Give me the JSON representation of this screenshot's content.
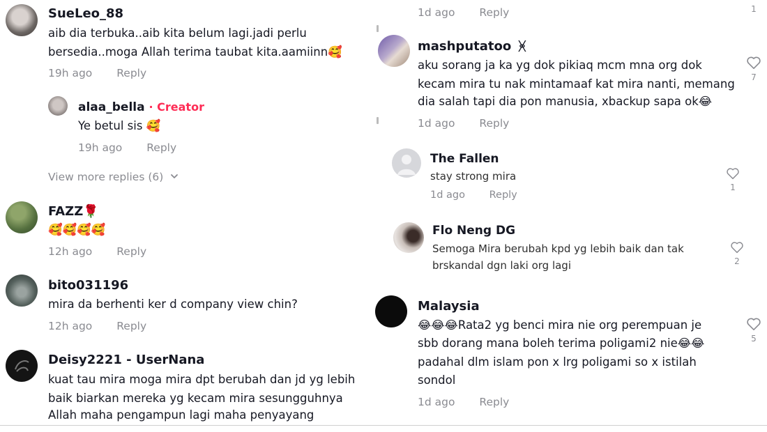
{
  "left": {
    "comments": [
      {
        "username": "SueLeo_88",
        "lines": [
          "aib dia terbuka..aib kita belum lagi.jadi perlu",
          "bersedia..moga Allah terima taubat kita.aamiinn🥰"
        ],
        "time": "19h ago",
        "reply": "Reply"
      },
      {
        "username": "alaa_bella",
        "creator_badge": "· Creator",
        "lines": [
          "Ye betul sis 🥰"
        ],
        "time": "19h ago",
        "reply": "Reply"
      },
      {
        "username": "FAZZ🌹",
        "lines": [
          "🥰🥰🥰🥰"
        ],
        "time": "12h ago",
        "reply": "Reply"
      },
      {
        "username": "bito031196",
        "lines": [
          "mira da berhenti ker d company view chin?"
        ],
        "time": "12h ago",
        "reply": "Reply"
      },
      {
        "username": "Deisy2221 - UserNana",
        "lines": [
          "kuat tau mira moga mira dpt berubah dan jd yg lebih",
          "baik biarkan mereka yg kecam mira sesungguhnya",
          "Allah maha pengampun lagi maha penyayang"
        ]
      }
    ],
    "view_more": "View more replies (6)"
  },
  "right": {
    "top_meta": {
      "time": "1d ago",
      "reply": "Reply",
      "count": "1"
    },
    "comments": [
      {
        "username": "mashputatoo",
        "user_suffix": "ᚸ",
        "lines": [
          "aku sorang ja ka yg dok pikiaq mcm mna org dok",
          "kecam mira tu nak mintamaaf kat mira nanti, memang",
          "dia salah tapi dia pon manusia, xbackup sapa ok😂"
        ],
        "time": "1d ago",
        "reply": "Reply",
        "likes": "7"
      },
      {
        "username": "The Fallen",
        "lines": [
          "stay strong mira"
        ],
        "time": "1d ago",
        "reply": "Reply",
        "likes": "1"
      },
      {
        "username": "Flo Neng DG",
        "lines": [
          "Semoga Mira berubah kpd yg lebih baik dan tak",
          "brskandal dgn laki org lagi"
        ],
        "likes": "2"
      },
      {
        "username": "Malaysia",
        "lines": [
          "😂😂😂Rata2 yg benci mira nie org perempuan je",
          "sbb dorang mana boleh terima poligami2 nie😂😂",
          "padahal dlm islam pon x lrg poligami so x istilah",
          "sondol"
        ],
        "time": "1d ago",
        "reply": "Reply",
        "likes": "5"
      }
    ]
  },
  "icons": {
    "heart": "heart-outline-icon",
    "chevron": "chevron-down-icon"
  },
  "colors": {
    "creator": "#fe2c55",
    "muted": "#8a8b91",
    "text": "#161823"
  }
}
